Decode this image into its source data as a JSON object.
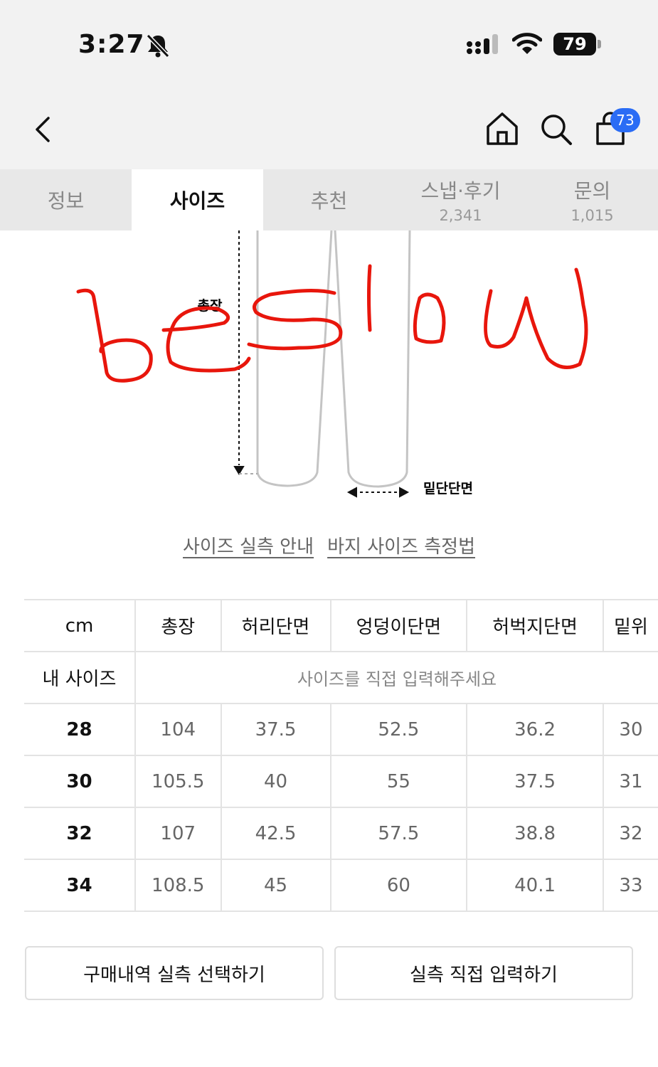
{
  "status_bar": {
    "time": "3:27",
    "battery": "79"
  },
  "header": {
    "cart_count": "73"
  },
  "tabs": [
    {
      "label": "정보",
      "count": ""
    },
    {
      "label": "사이즈",
      "count": ""
    },
    {
      "label": "추천",
      "count": ""
    },
    {
      "label": "스냅·후기",
      "count": "2,341"
    },
    {
      "label": "문의",
      "count": "1,015"
    }
  ],
  "diagram": {
    "length_label": "총장",
    "hem_label": "밑단단면",
    "handwriting": "beslow",
    "handwriting_color": "#e8160c"
  },
  "links": {
    "size_guide": "사이즈 실측 안내",
    "pants_measure": "바지 사이즈 측정법"
  },
  "size_table": {
    "unit": "cm",
    "columns": [
      "총장",
      "허리단면",
      "엉덩이단면",
      "허벅지단면",
      "밑위"
    ],
    "my_size_label": "내 사이즈",
    "my_size_prompt": "사이즈를 직접 입력해주세요",
    "rows": [
      {
        "size": "28",
        "values": [
          "104",
          "37.5",
          "52.5",
          "36.2",
          "30"
        ]
      },
      {
        "size": "30",
        "values": [
          "105.5",
          "40",
          "55",
          "37.5",
          "31"
        ]
      },
      {
        "size": "32",
        "values": [
          "107",
          "42.5",
          "57.5",
          "38.8",
          "32"
        ]
      },
      {
        "size": "34",
        "values": [
          "108.5",
          "45",
          "60",
          "40.1",
          "33"
        ]
      }
    ]
  },
  "buttons": {
    "purchase_history": "구매내역 실측 선택하기",
    "direct_input": "실측 직접 입력하기"
  }
}
